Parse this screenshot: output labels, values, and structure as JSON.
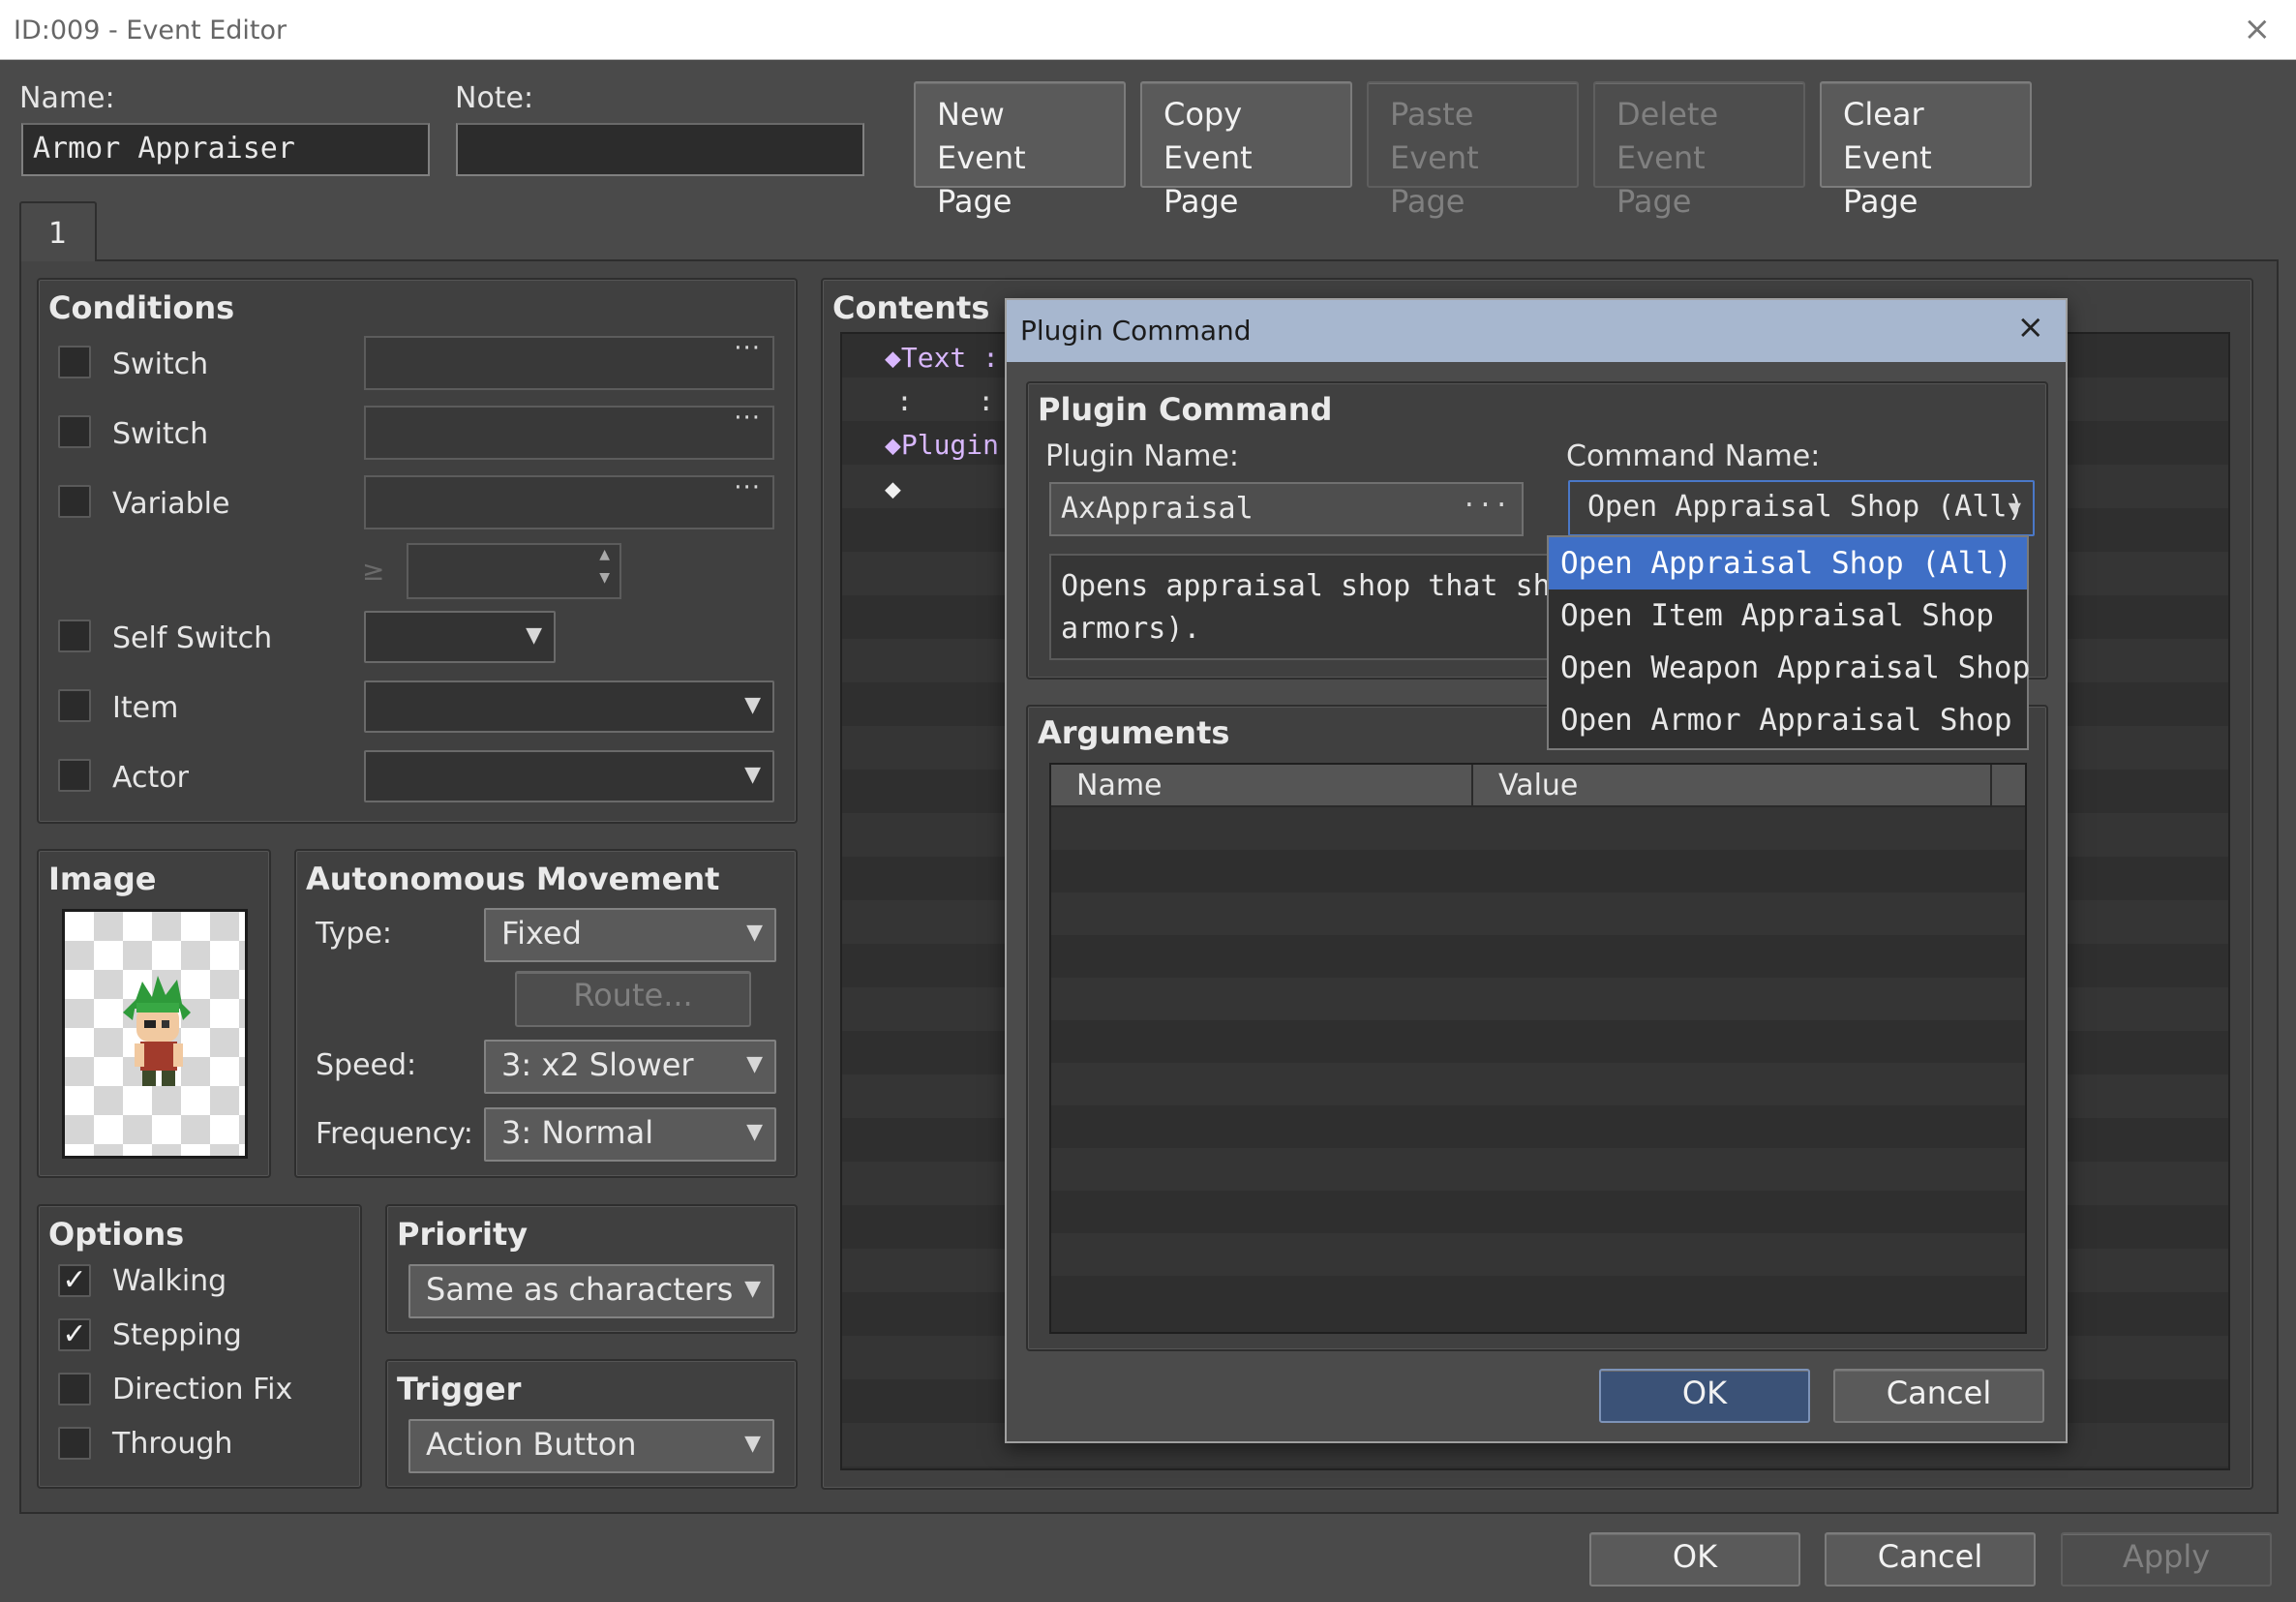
{
  "window": {
    "title": "ID:009 - Event Editor"
  },
  "event": {
    "name_label": "Name:",
    "name_value": "Armor Appraiser",
    "note_label": "Note:",
    "note_value": ""
  },
  "page_buttons": [
    {
      "line1": "New",
      "line2": "Event Page",
      "enabled": true
    },
    {
      "line1": "Copy",
      "line2": "Event Page",
      "enabled": true
    },
    {
      "line1": "Paste",
      "line2": "Event Page",
      "enabled": false
    },
    {
      "line1": "Delete",
      "line2": "Event Page",
      "enabled": false
    },
    {
      "line1": "Clear",
      "line2": "Event Page",
      "enabled": true
    }
  ],
  "tabs": [
    "1"
  ],
  "conditions": {
    "title": "Conditions",
    "switch1": "Switch",
    "switch2": "Switch",
    "variable": "Variable",
    "gte": "≥",
    "self_switch": "Self Switch",
    "item": "Item",
    "actor": "Actor",
    "dots": "···"
  },
  "image": {
    "title": "Image"
  },
  "movement": {
    "title": "Autonomous Movement",
    "type_label": "Type:",
    "type_value": "Fixed",
    "route_label": "Route...",
    "speed_label": "Speed:",
    "speed_value": "3: x2 Slower",
    "frequency_label": "Frequency:",
    "frequency_value": "3: Normal"
  },
  "options": {
    "title": "Options",
    "items": [
      {
        "label": "Walking",
        "checked": true
      },
      {
        "label": "Stepping",
        "checked": true
      },
      {
        "label": "Direction Fix",
        "checked": false
      },
      {
        "label": "Through",
        "checked": false
      }
    ],
    "check_glyph": "✓"
  },
  "priority": {
    "title": "Priority",
    "value": "Same as characters"
  },
  "trigger": {
    "title": "Trigger",
    "value": "Action Button"
  },
  "contents": {
    "title": "Contents",
    "lines": [
      "◆Text :",
      ":    :",
      "◆Plugin",
      "◆"
    ]
  },
  "footer": {
    "ok": "OK",
    "cancel": "Cancel",
    "apply": "Apply"
  },
  "plugin_dialog": {
    "title": "Plugin Command",
    "close": "×",
    "group_title": "Plugin Command",
    "plugin_name_label": "Plugin Name:",
    "plugin_name_value": "AxAppraisal",
    "command_name_label": "Command Name:",
    "command_name_value": "Open Appraisal Shop (All)",
    "description_line1": "Opens appraisal shop that shows a",
    "description_line2": "armors).",
    "arguments_title": "Arguments",
    "columns": [
      "Name",
      "Value"
    ],
    "dropdown_options": [
      "Open Appraisal Shop (All)",
      "Open Item Appraisal Shop",
      "Open Weapon Appraisal Shop",
      "Open Armor Appraisal Shop"
    ],
    "selected_index": 0,
    "ok": "OK",
    "cancel": "Cancel"
  },
  "icons": {
    "close": "×",
    "dropdown_arrow": "▼",
    "spin_up": "▲",
    "spin_down": "▼",
    "ellipsis": "···"
  }
}
